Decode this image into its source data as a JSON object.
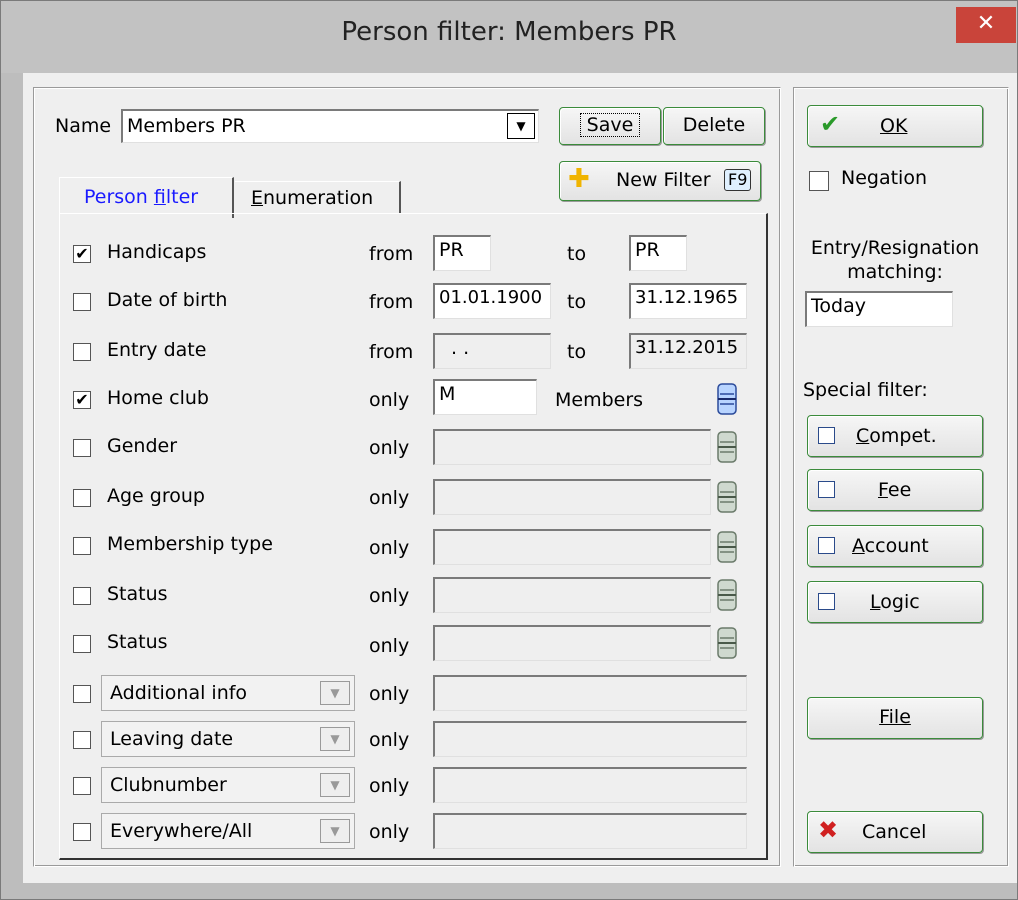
{
  "window": {
    "title": "Person filter: Members PR",
    "close_icon": "close-icon"
  },
  "name": {
    "label": "Name",
    "value": "Members PR"
  },
  "buttons": {
    "save": "Save",
    "delete": "Delete",
    "new_filter": "New Filter",
    "new_filter_key": "F9"
  },
  "tabs": [
    {
      "label": "Person filter",
      "active": true
    },
    {
      "label": "Enumeration",
      "active": false
    }
  ],
  "rows": [
    {
      "label": "Handicaps",
      "checked": true,
      "mode": "from",
      "from": "PR",
      "to_label": "to",
      "to": "PR"
    },
    {
      "label": "Date of birth",
      "checked": false,
      "mode": "from",
      "from": "01.01.1900",
      "to_label": "to",
      "to": "31.12.1965"
    },
    {
      "label": "Entry date",
      "checked": false,
      "mode": "from",
      "from": " .  .",
      "to_label": "to",
      "to": "31.12.2015"
    },
    {
      "label": "Home club",
      "checked": true,
      "mode": "only",
      "value": "M",
      "desc": "Members"
    },
    {
      "label": "Gender",
      "checked": false,
      "mode": "only",
      "value": ""
    },
    {
      "label": "Age group",
      "checked": false,
      "mode": "only",
      "value": ""
    },
    {
      "label": "Membership type",
      "checked": false,
      "mode": "only",
      "value": ""
    },
    {
      "label": "Status",
      "checked": false,
      "mode": "only",
      "value": ""
    },
    {
      "label": "Status",
      "checked": false,
      "mode": "only",
      "value": ""
    }
  ],
  "combo_rows": [
    {
      "field": "Additional info",
      "checked": false,
      "mode": "only",
      "value": ""
    },
    {
      "field": "Leaving date",
      "checked": false,
      "mode": "only",
      "value": ""
    },
    {
      "field": "Clubnumber",
      "checked": false,
      "mode": "only",
      "value": ""
    },
    {
      "field": "Everywhere/All",
      "checked": false,
      "mode": "only",
      "value": ""
    }
  ],
  "right": {
    "ok": "OK",
    "negation": "Negation",
    "negation_checked": false,
    "entry_label_1": "Entry/Resignation",
    "entry_label_2": "matching:",
    "entry_value": "Today",
    "special_label": "Special filter:",
    "special": [
      "Compet.",
      "Fee",
      "Account",
      "Logic"
    ],
    "file": "File",
    "cancel": "Cancel"
  },
  "colors": {
    "accent_border": "#3b8b3b",
    "tab_active_text": "#1a1aff",
    "close_bg": "#c9443a",
    "ok_check": "#2a9a2a",
    "cancel_x": "#d02020"
  }
}
